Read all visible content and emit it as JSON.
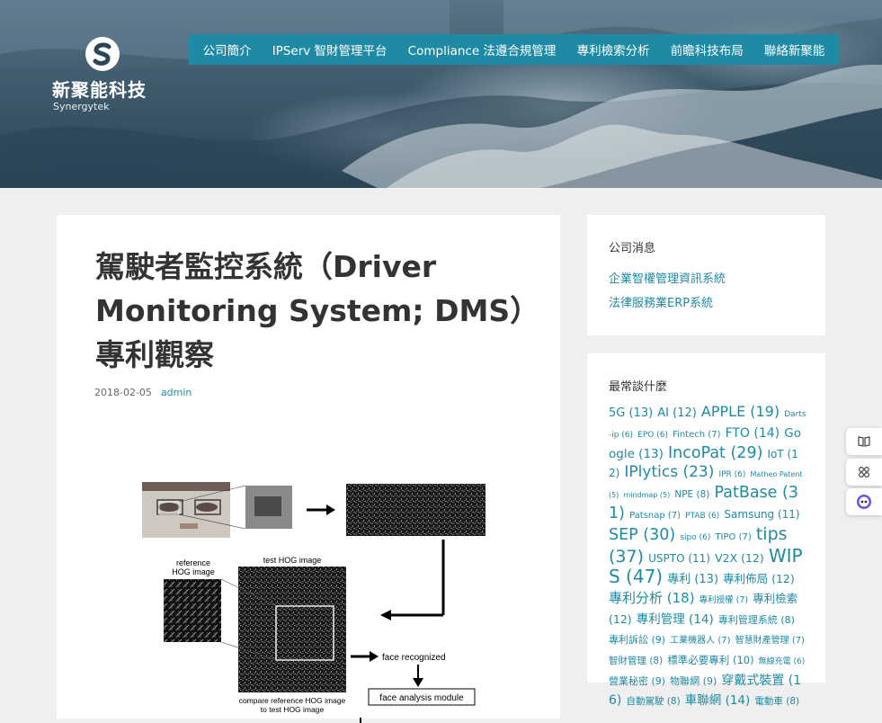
{
  "site": {
    "name": "新聚能科技",
    "tagline": "Synergytek"
  },
  "nav": {
    "items": [
      "公司簡介",
      "IPServ 智財管理平台",
      "Compliance 法遵合規管理",
      "專利檢索分析",
      "前瞻科技布局",
      "聯絡新聚能"
    ]
  },
  "post": {
    "title": "駕駛者監控系統（Driver Monitoring System; DMS）專利觀察",
    "date": "2018-02-05",
    "author": "admin",
    "figure": {
      "label_reference": "reference",
      "label_hog_image": "HOG image",
      "label_test": "test HOG image",
      "label_compare_1": "compare reference HOG image",
      "label_compare_2": "to test HOG image",
      "label_face_recognized": "face recognized",
      "label_face_analysis": "face analysis module"
    }
  },
  "sidebar": {
    "news": {
      "title": "公司消息",
      "links": [
        "企業智權管理資訊系統",
        "法律服務業ERP系統"
      ]
    },
    "tagcloud": {
      "title": "最常談什麼",
      "tags": [
        {
          "t": "5G (13)",
          "s": 13
        },
        {
          "t": "AI (12)",
          "s": 13
        },
        {
          "t": "APPLE (19)",
          "s": 16
        },
        {
          "t": "Darts-ip (6)",
          "s": 9
        },
        {
          "t": "EPO (6)",
          "s": 9
        },
        {
          "t": "Fintech (7)",
          "s": 10
        },
        {
          "t": "FTO (14)",
          "s": 14
        },
        {
          "t": "Google (13)",
          "s": 13.5
        },
        {
          "t": "IncoPat (29)",
          "s": 17.5
        },
        {
          "t": "IoT (12)",
          "s": 12
        },
        {
          "t": "IPlytics (23)",
          "s": 17
        },
        {
          "t": "IPR (6)",
          "s": 9
        },
        {
          "t": "Matheo Patent (5)",
          "s": 8
        },
        {
          "t": "mindmap (5)",
          "s": 8
        },
        {
          "t": "NPE (8)",
          "s": 10.5
        },
        {
          "t": "PatBase (31)",
          "s": 17.5
        },
        {
          "t": "Patsnap (7)",
          "s": 10
        },
        {
          "t": "PTAB (6)",
          "s": 9
        },
        {
          "t": "Samsung (11)",
          "s": 12
        },
        {
          "t": "SEP (30)",
          "s": 17.5
        },
        {
          "t": "sipo (6)",
          "s": 9
        },
        {
          "t": "TIPO (7)",
          "s": 10
        },
        {
          "t": "tips (37)",
          "s": 19
        },
        {
          "t": "USPTO (11)",
          "s": 12
        },
        {
          "t": "V2X (12)",
          "s": 12.5
        },
        {
          "t": "WIPS (47)",
          "s": 20
        },
        {
          "t": "專利 (13)",
          "s": 13
        },
        {
          "t": "專利佈局 (12)",
          "s": 12.5
        },
        {
          "t": "專利分析 (18)",
          "s": 15
        },
        {
          "t": "專利授權 (7)",
          "s": 9.5
        },
        {
          "t": "專利檢索 (12)",
          "s": 12.5
        },
        {
          "t": "專利管理 (14)",
          "s": 13.5
        },
        {
          "t": "專利管理系統 (8)",
          "s": 11
        },
        {
          "t": "專利訴訟 (9)",
          "s": 11
        },
        {
          "t": "工業機器人 (7)",
          "s": 10
        },
        {
          "t": "智慧財產管理 (7)",
          "s": 10
        },
        {
          "t": "智財管理 (8)",
          "s": 10.5
        },
        {
          "t": "標準必要專利 (10)",
          "s": 11.5
        },
        {
          "t": "無線充電 (6)",
          "s": 9
        },
        {
          "t": "營業秘密 (9)",
          "s": 11
        },
        {
          "t": "物聯網 (9)",
          "s": 11
        },
        {
          "t": "穿戴式裝置 (16)",
          "s": 14
        },
        {
          "t": "自動駕駛 (8)",
          "s": 10.5
        },
        {
          "t": "車聯網 (14)",
          "s": 13.5
        },
        {
          "t": "電動車 (8)",
          "s": 10.5
        }
      ]
    }
  },
  "colors": {
    "accent": "#1e8aa3",
    "page_bg": "#efefef"
  },
  "icons": [
    "logo-mark-icon",
    "book-icon",
    "grid-icon",
    "chatbot-icon"
  ]
}
